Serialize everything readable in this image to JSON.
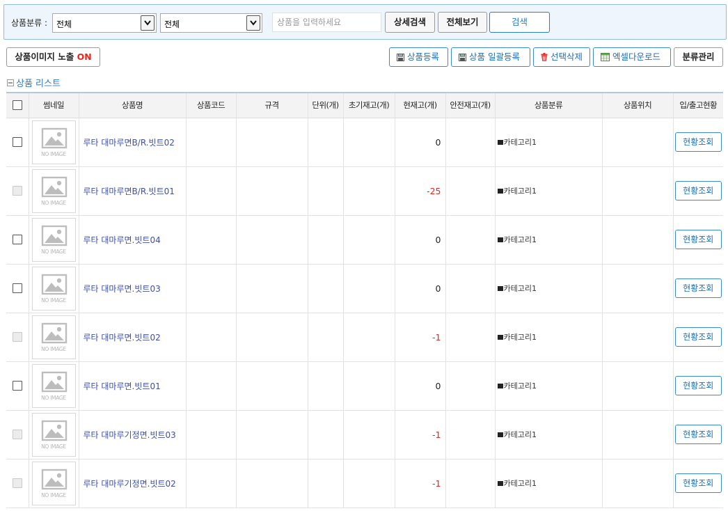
{
  "search": {
    "category_label": "상품분류 :",
    "category_select_1": "전체",
    "category_select_2": "전체",
    "keyword_placeholder": "상품을 입력하세요",
    "detail_search_label": "상세검색",
    "view_all_label": "전체보기",
    "search_label": "검색"
  },
  "toolbar": {
    "image_toggle_label": "상품이미지 노출",
    "image_toggle_state": "ON",
    "register_label": "상품등록",
    "bulk_register_label": "상품 일괄등록",
    "delete_selected_label": "선택삭제",
    "excel_download_label": "엑셀다운로드",
    "category_manage_label": "분류관리"
  },
  "list": {
    "title": "상품 리스트",
    "columns": [
      "썸네일",
      "상품명",
      "상품코드",
      "규격",
      "단위(개)",
      "초기재고(개)",
      "현재고(개)",
      "안전재고(개)",
      "상품분류",
      "상품위치",
      "입/출고현황"
    ],
    "no_image_text": "NO IMAGE",
    "status_button_label": "현황조회",
    "rows": [
      {
        "name": "루타 대마루면B/R.빗트02",
        "code": "",
        "spec": "",
        "unit": "",
        "initial_stock": "",
        "current_stock": "0",
        "safety_stock": "",
        "category": "카테고리1",
        "location": "",
        "negative": false,
        "checkbox_disabled": false
      },
      {
        "name": "루타 대마루면B/R.빗트01",
        "code": "",
        "spec": "",
        "unit": "",
        "initial_stock": "",
        "current_stock": "-25",
        "safety_stock": "",
        "category": "카테고리1",
        "location": "",
        "negative": true,
        "checkbox_disabled": true
      },
      {
        "name": "루타 대마루면.빗트04",
        "code": "",
        "spec": "",
        "unit": "",
        "initial_stock": "",
        "current_stock": "0",
        "safety_stock": "",
        "category": "카테고리1",
        "location": "",
        "negative": false,
        "checkbox_disabled": false
      },
      {
        "name": "루타 대마루면.빗트03",
        "code": "",
        "spec": "",
        "unit": "",
        "initial_stock": "",
        "current_stock": "0",
        "safety_stock": "",
        "category": "카테고리1",
        "location": "",
        "negative": false,
        "checkbox_disabled": false
      },
      {
        "name": "루타 대마루면.빗트02",
        "code": "",
        "spec": "",
        "unit": "",
        "initial_stock": "",
        "current_stock": "-1",
        "safety_stock": "",
        "category": "카테고리1",
        "location": "",
        "negative": true,
        "checkbox_disabled": true
      },
      {
        "name": "루타 대마루면.빗트01",
        "code": "",
        "spec": "",
        "unit": "",
        "initial_stock": "",
        "current_stock": "0",
        "safety_stock": "",
        "category": "카테고리1",
        "location": "",
        "negative": false,
        "checkbox_disabled": false
      },
      {
        "name": "루타 대마루기정면.빗트03",
        "code": "",
        "spec": "",
        "unit": "",
        "initial_stock": "",
        "current_stock": "-1",
        "safety_stock": "",
        "category": "카테고리1",
        "location": "",
        "negative": true,
        "checkbox_disabled": true
      },
      {
        "name": "루타 대마루기정면.빗트02",
        "code": "",
        "spec": "",
        "unit": "",
        "initial_stock": "",
        "current_stock": "-1",
        "safety_stock": "",
        "category": "카테고리1",
        "location": "",
        "negative": true,
        "checkbox_disabled": true
      }
    ]
  },
  "colors": {
    "accent_blue": "#2a7dc4",
    "link_blue": "#3e4fa8",
    "negative_red": "#e4261c",
    "search_bg": "#eef5fc"
  },
  "icons": {
    "select_arrow": "chevron-down-icon",
    "register": "save-icon",
    "bulk_register": "save-icon",
    "delete": "trash-icon",
    "excel": "excel-icon",
    "list_title": "minus-box-icon",
    "category_marker": "square-icon"
  }
}
